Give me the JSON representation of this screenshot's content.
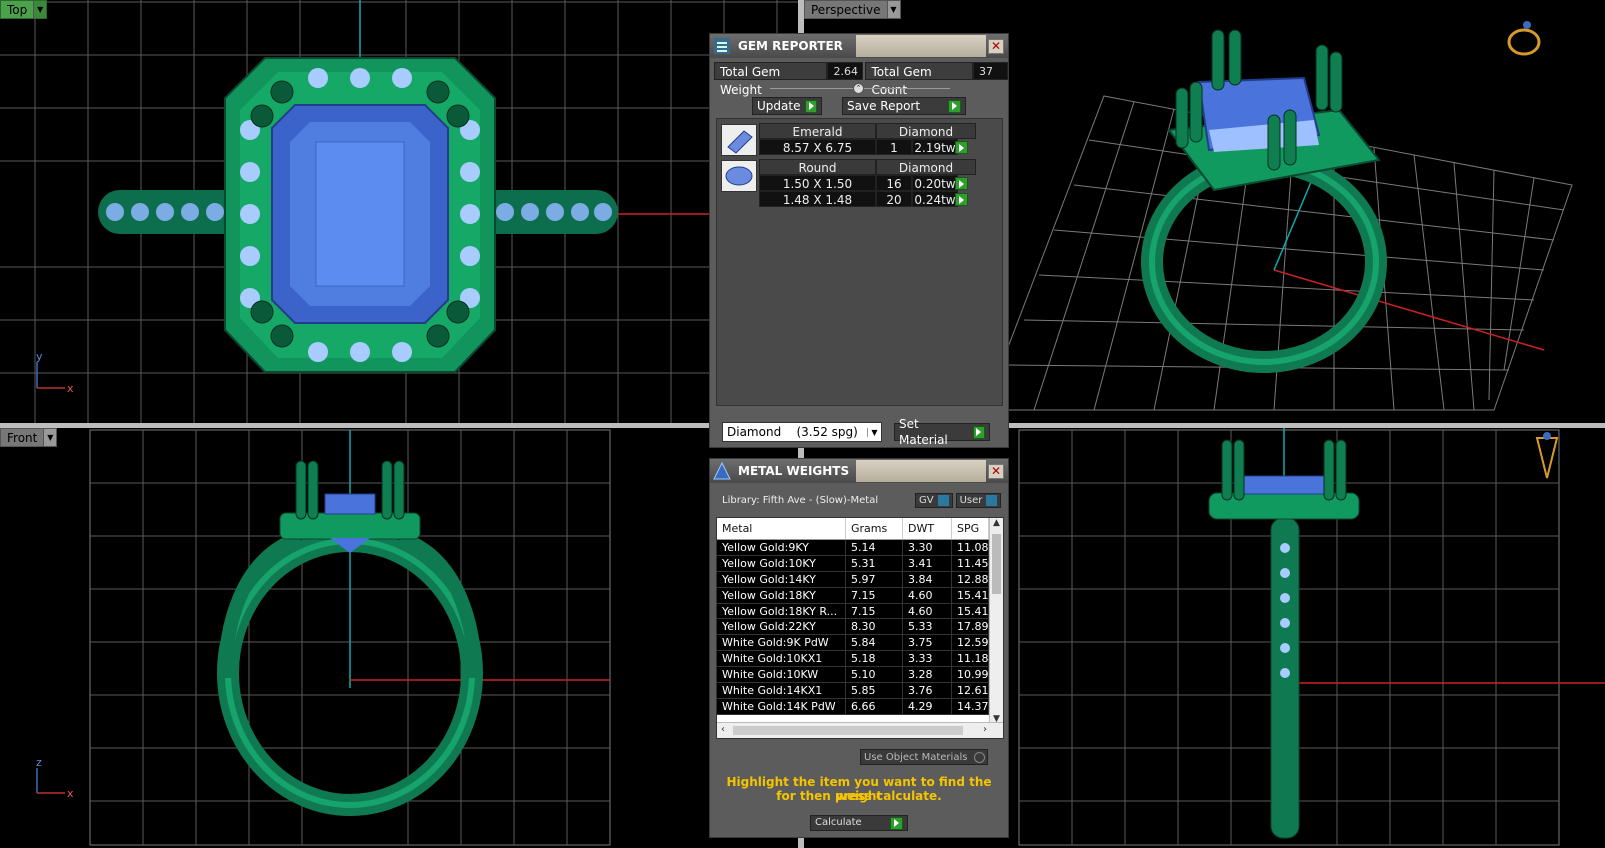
{
  "viewports": {
    "top": {
      "label": "Top"
    },
    "perspective": {
      "label": "Perspective"
    },
    "front": {
      "label": "Front"
    },
    "right": {
      "label": ""
    }
  },
  "axes": {
    "top": {
      "x": "x",
      "y": "y"
    },
    "front": {
      "x": "x",
      "y": "z"
    }
  },
  "gem_reporter": {
    "title": "GEM REPORTER",
    "total_gem_weight_label": "Total Gem Weight",
    "total_gem_weight": "2.64",
    "total_gem_count_label": "Total Gem Count",
    "total_gem_count": "37",
    "update_label": "Update",
    "save_report_label": "Save Report",
    "groups": [
      {
        "shape": "Emerald",
        "material": "Diamond",
        "rows": [
          {
            "size": "8.57 X 6.75",
            "count": "1",
            "weight": "2.19tw"
          }
        ]
      },
      {
        "shape": "Round",
        "material": "Diamond",
        "rows": [
          {
            "size": "1.50 X 1.50",
            "count": "16",
            "weight": "0.20tw"
          },
          {
            "size": "1.48 X 1.48",
            "count": "20",
            "weight": "0.24tw"
          }
        ]
      }
    ],
    "material_select": "Diamond    (3.52 spg)",
    "set_material_label": "Set Material"
  },
  "metal_weights": {
    "title": "METAL WEIGHTS",
    "library": "Library: Fifth Ave - (Slow)-Metal",
    "gv_label": "GV",
    "user_label": "User",
    "columns": [
      "Metal",
      "Grams",
      "DWT",
      "SPG"
    ],
    "rows": [
      [
        "Yellow Gold:9KY",
        "5.14",
        "3.30",
        "11.08"
      ],
      [
        "Yellow Gold:10KY",
        "5.31",
        "3.41",
        "11.45"
      ],
      [
        "Yellow Gold:14KY",
        "5.97",
        "3.84",
        "12.88"
      ],
      [
        "Yellow Gold:18KY",
        "7.15",
        "4.60",
        "15.41"
      ],
      [
        "Yellow Gold:18KY R...",
        "7.15",
        "4.60",
        "15.41"
      ],
      [
        "Yellow Gold:22KY",
        "8.30",
        "5.33",
        "17.89"
      ],
      [
        "White Gold:9K PdW",
        "5.84",
        "3.75",
        "12.59"
      ],
      [
        "White Gold:10KX1",
        "5.18",
        "3.33",
        "11.18"
      ],
      [
        "White Gold:10KW",
        "5.10",
        "3.28",
        "10.99"
      ],
      [
        "White Gold:14KX1",
        "5.85",
        "3.76",
        "12.61"
      ],
      [
        "White Gold:14K PdW",
        "6.66",
        "4.29",
        "14.37"
      ]
    ],
    "use_object_materials_label": "Use Object Materials",
    "message_line1": "Highlight the item you want to find the weight",
    "message_line2": "for then press calculate.",
    "calculate_label": "Calculate"
  }
}
